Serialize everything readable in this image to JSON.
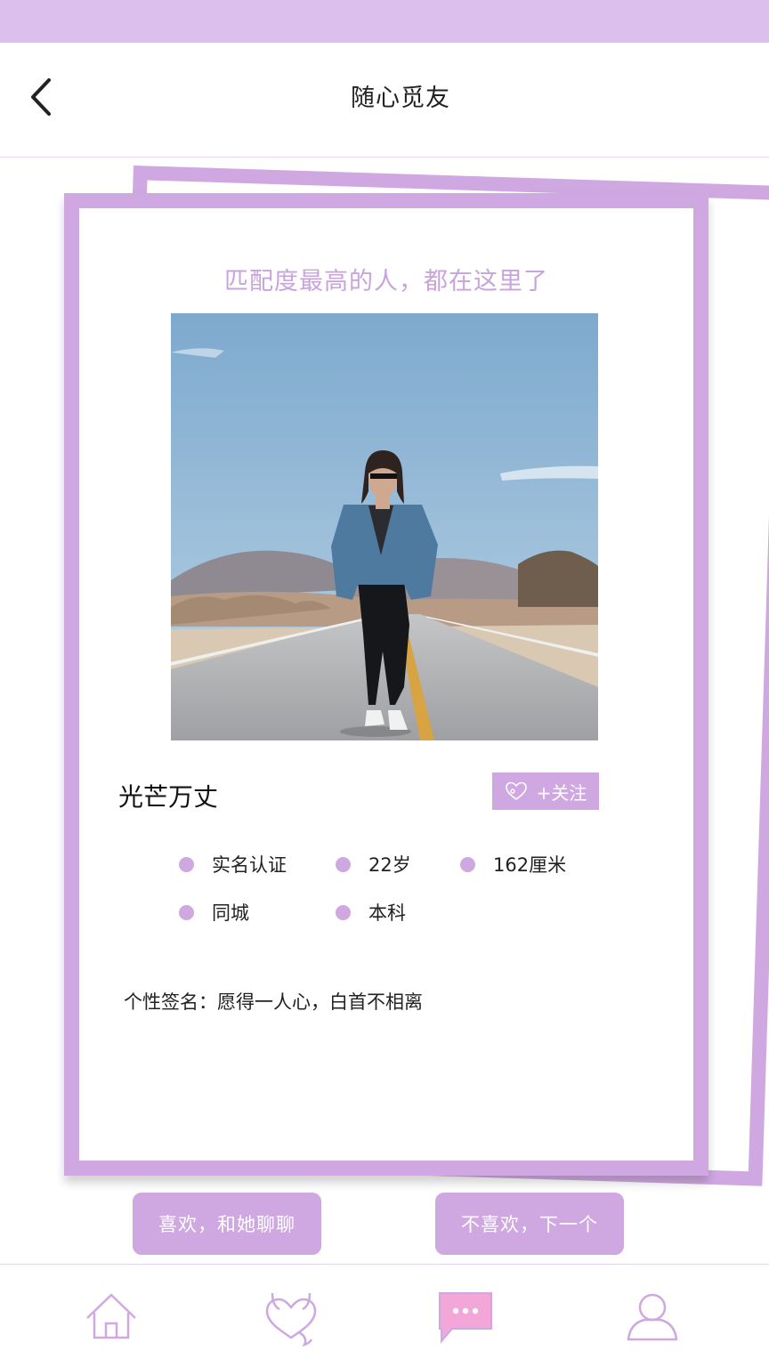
{
  "nav": {
    "title": "随心觅友",
    "back_icon": "chevron-left-icon"
  },
  "card": {
    "tagline": "匹配度最高的人，都在这里了",
    "name": "光芒万丈",
    "follow_label": "+关注",
    "attributes": [
      "实名认证",
      "22岁",
      "162厘米",
      "同城",
      "本科"
    ],
    "signature": "个性签名：愿得一人心，白首不相离"
  },
  "actions": {
    "like": "喜欢，和她聊聊",
    "dislike": "不喜欢，下一个"
  },
  "tabs": [
    "home-icon",
    "devil-heart-icon",
    "chat-bubble-icon",
    "user-icon"
  ],
  "colors": {
    "accent": "#cfa7e1",
    "status_bar": "#dcbfec",
    "tagline": "#c9a3dc",
    "chat_active": "#f3a6d8"
  }
}
